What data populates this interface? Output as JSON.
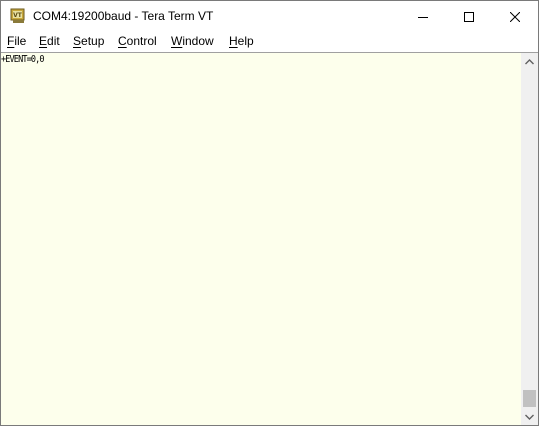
{
  "window": {
    "title": "COM4:19200baud - Tera Term VT",
    "app_icon": "teraterm-vt-icon"
  },
  "caption_buttons": {
    "minimize_icon": "minimize-icon",
    "maximize_icon": "maximize-icon",
    "close_icon": "close-icon"
  },
  "menu": {
    "items": [
      {
        "access_key": "F",
        "rest": "ile"
      },
      {
        "access_key": "E",
        "rest": "dit"
      },
      {
        "access_key": "S",
        "rest": "etup"
      },
      {
        "access_key": "C",
        "rest": "ontrol"
      },
      {
        "access_key": "W",
        "rest": "indow"
      },
      {
        "access_key": "H",
        "rest": "elp"
      }
    ]
  },
  "terminal": {
    "lines": [
      "+EVENT=0,0"
    ],
    "background_color": "#fdffec",
    "text_color": "#000000"
  },
  "scrollbar": {
    "up_icon": "scroll-up-arrow-icon",
    "down_icon": "scroll-down-arrow-icon",
    "position": "bottom"
  }
}
